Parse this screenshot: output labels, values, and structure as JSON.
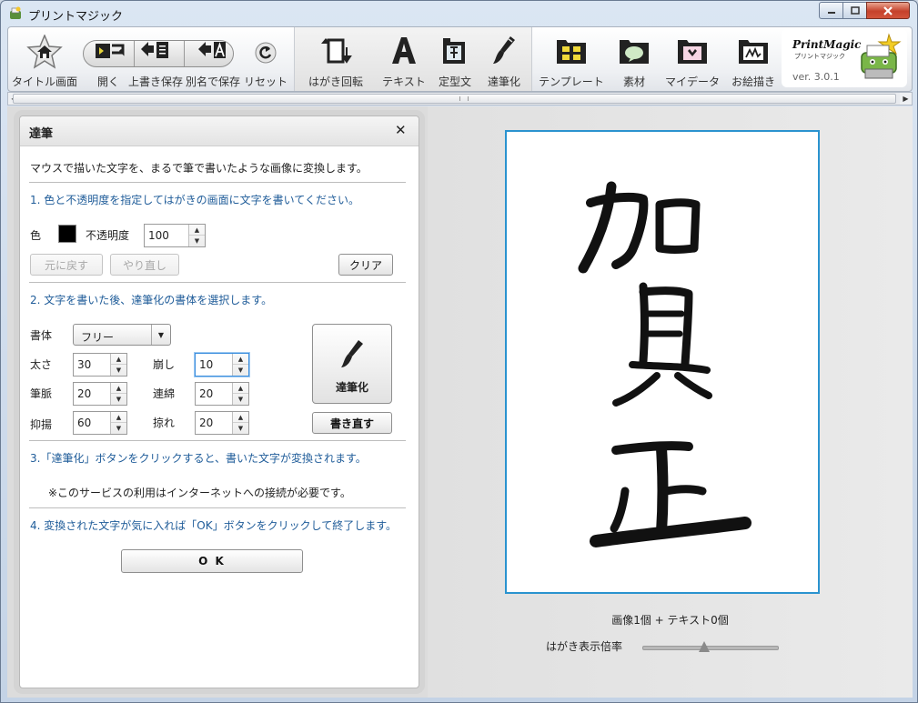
{
  "window": {
    "title": "プリントマジック"
  },
  "toolbar": {
    "title_screen": "タイトル画面",
    "open": "開く",
    "overwrite_save": "上書き保存",
    "save_as": "別名で保存",
    "reset": "リセット",
    "rotate_postcard": "はがき回転",
    "text": "テキスト",
    "template_phrase": "定型文",
    "brush": "達筆化",
    "template": "テンプレート",
    "material": "素材",
    "my_data": "マイデータ",
    "drawing": "お絵描き",
    "logo_text": "PrintMagic",
    "logo_sub": "プリントマジック",
    "version": "ver. 3.0.1"
  },
  "panel": {
    "title": "達筆",
    "intro": "マウスで描いた文字を、まるで筆で書いたような画像に変換します。",
    "step1": "1. 色と不透明度を指定してはがきの画面に文字を書いてください。",
    "color_label": "色",
    "color_value": "#000000",
    "opacity_label": "不透明度",
    "opacity_value": "100",
    "undo": "元に戻す",
    "redo": "やり直し",
    "clear": "クリア",
    "step2": "2. 文字を書いた後、達筆化の書体を選択します。",
    "font_label": "書体",
    "font_value": "フリー",
    "thickness_label": "太さ",
    "thickness_value": "30",
    "distort_label": "崩し",
    "distort_value": "10",
    "vein_label": "筆脈",
    "vein_value": "20",
    "connect_label": "連綿",
    "connect_value": "20",
    "modulation_label": "抑揚",
    "modulation_value": "60",
    "scratch_label": "掠れ",
    "scratch_value": "20",
    "brush_button": "達筆化",
    "rewrite_button": "書き直す",
    "step3": "3.「達筆化」ボタンをクリックすると、書いた文字が変換されます。",
    "note": "※このサービスの利用はインターネットへの接続が必要です。",
    "step4": "4. 変換された文字が気に入れば「OK」ボタンをクリックして終了します。",
    "ok": "O K"
  },
  "preview": {
    "count": "画像1個 + テキスト0個",
    "zoom_label": "はがき表示倍率",
    "zoom_level": 0.45
  }
}
